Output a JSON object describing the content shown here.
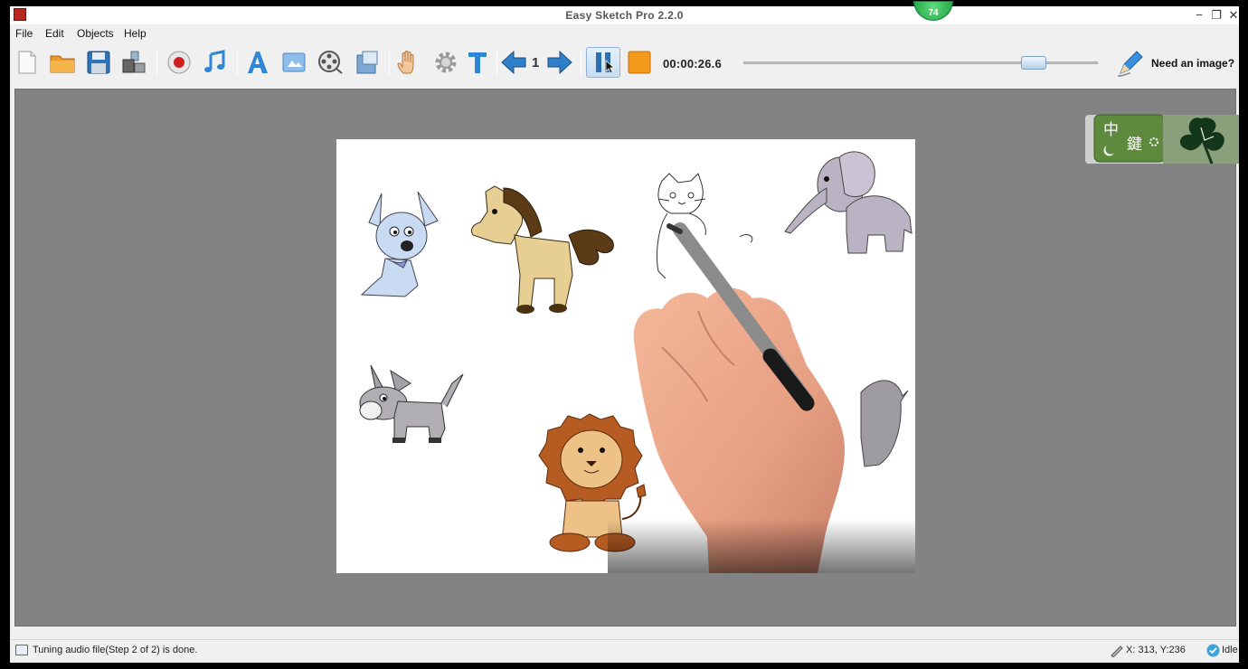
{
  "window": {
    "title": "Easy Sketch Pro 2.2.0",
    "badge_count": "74",
    "minimize": "−",
    "maximize": "❐",
    "close": "✕"
  },
  "menu": {
    "items": [
      "File",
      "Edit",
      "Objects",
      "Help"
    ]
  },
  "toolbar": {
    "page_number": "1",
    "timer": "00:00:26.6",
    "need_image_label": "Need an image?",
    "timeline_position": 0.82
  },
  "ime": {
    "chars": [
      "中",
      "鍵"
    ]
  },
  "status": {
    "message": "Tuning audio file(Step 2 of 2) is done.",
    "coordinates": "X: 313, Y:236",
    "state": "Idle"
  },
  "colors": {
    "accent_blue": "#2f86d6",
    "record_red": "#d11f1f",
    "orange_stop": "#f39a1c",
    "canvas_gray": "#838383"
  }
}
